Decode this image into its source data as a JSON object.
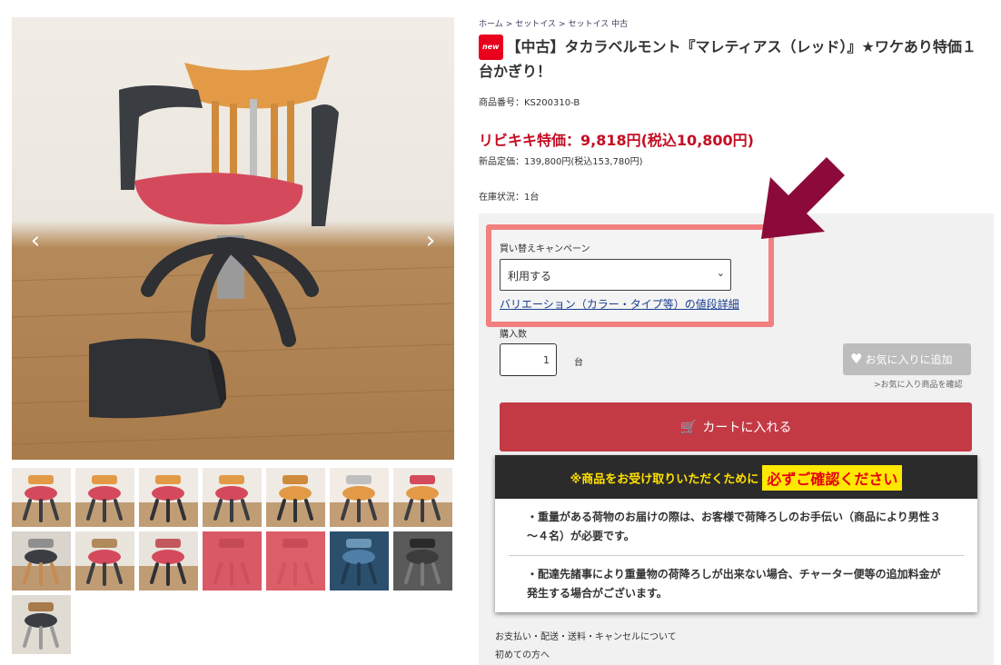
{
  "gallery": {
    "prev_arrow": "‹",
    "next_arrow": "›",
    "thumbnails": [
      {
        "name": "thumb-1"
      },
      {
        "name": "thumb-2"
      },
      {
        "name": "thumb-3"
      },
      {
        "name": "thumb-4"
      },
      {
        "name": "thumb-5"
      },
      {
        "name": "thumb-6"
      },
      {
        "name": "thumb-7"
      },
      {
        "name": "thumb-8"
      },
      {
        "name": "thumb-9"
      },
      {
        "name": "thumb-10"
      },
      {
        "name": "thumb-11"
      },
      {
        "name": "thumb-12"
      },
      {
        "name": "thumb-13"
      },
      {
        "name": "thumb-14"
      },
      {
        "name": "thumb-15"
      }
    ]
  },
  "breadcrumb": {
    "items": [
      "ホーム",
      "セットイス",
      "セットイス 中古"
    ],
    "separator": ">"
  },
  "product": {
    "badge": "new",
    "title": "【中古】タカラベルモント『マレティアス（レッド）』★ワケあり特価１台かぎり！",
    "sku": "商品番号：KS200310-B",
    "price": "リビキキ特価：9,818円(税込10,800円)",
    "list_price": "新品定価：139,800円(税込153,780円)",
    "stock": "在庫状況：1台"
  },
  "campaign": {
    "label": "買い替えキャンペーン",
    "select_value": "利用する",
    "variation_link": "バリエーション（カラー・タイプ等）の値段詳細"
  },
  "purchase": {
    "qty_label": "購入数",
    "qty_value": "1",
    "qty_unit": "台",
    "favorite_button": "お気に入りに追加",
    "favorite_link": ">お気に入り商品を確認",
    "cart_button": "カートに入れる"
  },
  "notice": {
    "lead": "※商品をお受け取りいただくために",
    "emphasis": "必ずご確認ください",
    "items": [
      "・重量がある荷物のお届けの際は、お客様で荷降ろしのお手伝い（商品により男性３～４名）が必要です。",
      "・配達先諸事により重量物の荷降ろしが出来ない場合、チャーター便等の追加料金が発生する場合がございます。"
    ]
  },
  "footer_links": [
    "お支払い・配送・送料・キャンセルについて",
    "初めての方へ"
  ],
  "colors": {
    "price_red": "#c30d23",
    "cart_button": "#c33a45",
    "highlight_border": "#f28080",
    "arrow": "#8b0a3a",
    "notice_yellow": "#ffe800"
  }
}
